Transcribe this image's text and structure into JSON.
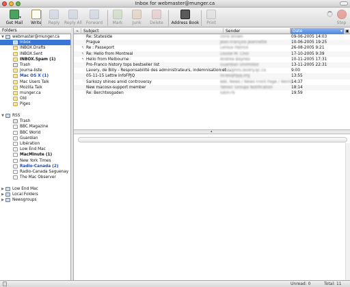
{
  "window": {
    "title": "Inbox for webmaster@munger.ca",
    "colors": {
      "close": "#e75b50",
      "minimize": "#f3b53a",
      "zoom": "#63b84a",
      "selection": "#3875d7"
    }
  },
  "toolbar": {
    "buttons": [
      {
        "label": "Get Mail",
        "enabled": true
      },
      {
        "label": "Write",
        "enabled": true
      },
      {
        "label": "Reply",
        "enabled": false
      },
      {
        "label": "Reply All",
        "enabled": false
      },
      {
        "label": "Forward",
        "enabled": false
      },
      {
        "label": "Mark",
        "enabled": false
      },
      {
        "label": "Junk",
        "enabled": false
      },
      {
        "label": "Delete",
        "enabled": false
      },
      {
        "label": "Address Book",
        "enabled": true
      },
      {
        "label": "Print",
        "enabled": false
      },
      {
        "label": "Stop",
        "enabled": false
      }
    ]
  },
  "folders": {
    "header": "Folders",
    "items": [
      {
        "label": "webmaster@munger.ca",
        "type": "account",
        "open": true,
        "bold": false
      },
      {
        "label": "Inbox",
        "selected": true
      },
      {
        "label": "INBOX.Drafts"
      },
      {
        "label": "INBOX.Sent"
      },
      {
        "label": "INBOX.Spam (1)",
        "bold": true
      },
      {
        "label": "Trash"
      },
      {
        "label": "Journa-liste"
      },
      {
        "label": "Mac OS X (1)",
        "bold": true,
        "blue": true
      },
      {
        "label": "Mac Users Talk"
      },
      {
        "label": "Mozilla Talk"
      },
      {
        "label": "munger.ca"
      },
      {
        "label": "Old"
      },
      {
        "label": "Piges"
      },
      {
        "label": "RSS",
        "type": "account",
        "open": true
      },
      {
        "label": "Trash"
      },
      {
        "label": "BBC Magazine"
      },
      {
        "label": "BBC World"
      },
      {
        "label": "Guardian"
      },
      {
        "label": "Libération"
      },
      {
        "label": "Low End Mac"
      },
      {
        "label": "MacMinute (1)",
        "bold": true
      },
      {
        "label": "New York Times"
      },
      {
        "label": "Radio-Canada (2)",
        "bold": true,
        "blue": true
      },
      {
        "label": "Radio-Canada Saguenay"
      },
      {
        "label": "The Mac Observer"
      },
      {
        "label": "Low End Mac",
        "type": "account",
        "open": false
      },
      {
        "label": "Local Folders",
        "type": "account",
        "open": false
      },
      {
        "label": "Newsgroups",
        "type": "account",
        "open": false
      }
    ]
  },
  "messageList": {
    "columns": {
      "subject": "Subject",
      "sender": "Sender",
      "date": "Date"
    },
    "rows": [
      {
        "subject": "Re: Stateside",
        "sender": "chris brown",
        "date": "09-06-2005 14:03",
        "replied": false
      },
      {
        "subject": "Prague",
        "sender": "Jean-François Jeannette",
        "date": "10-06-2005 19:25",
        "replied": false
      },
      {
        "subject": "Re : Passeport",
        "sender": "Leroux Patrice",
        "date": "26-08-2005 9:21",
        "replied": true
      },
      {
        "subject": "Re: Hello from Montreal",
        "sender": "Louise M. Choi",
        "date": "17-10-2005 9:39",
        "replied": true
      },
      {
        "subject": "Hello from Melbourne",
        "sender": "Andrea Baynes",
        "date": "10-11-2005 17:31",
        "replied": true
      },
      {
        "subject": "Pro-Franco history tops bestseller list",
        "sender": "Guardian Unlimited",
        "date": "13-11-2005 22:31",
        "replied": false
      },
      {
        "subject": "Lavery, de Billy - Responsabilité des administrateurs, indemnisation et ...",
        "sender": "envoi@nrs.lavery.qc.ca",
        "date": "9:00",
        "replied": false
      },
      {
        "subject": "05-11-15 Lettre InfoFPJQ",
        "sender": "lisTes@fpjq.org",
        "date": "13:55",
        "replied": false
      },
      {
        "subject": "Sarkozy shines amid controversy",
        "sender": "BBC News / News Front Page / World",
        "date": "14:37",
        "replied": false
      },
      {
        "subject": "New macosx-support member",
        "sender": "Yahoo! Groups Notification",
        "date": "18:14",
        "replied": false
      },
      {
        "subject": "Re: Berchtesgaden",
        "sender": "lubin76",
        "date": "19:59",
        "replied": false
      }
    ]
  },
  "status": {
    "unread": "Unread: 0",
    "total": "Total: 11"
  }
}
